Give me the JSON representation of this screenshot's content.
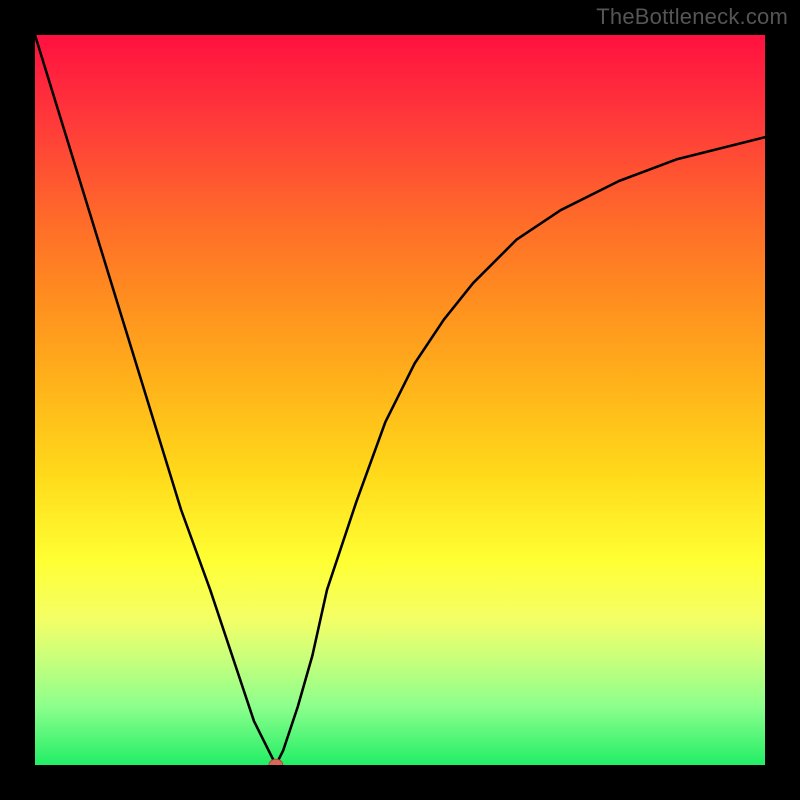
{
  "watermark": "TheBottleneck.com",
  "chart_data": {
    "type": "line",
    "title": "",
    "xlabel": "",
    "ylabel": "",
    "xlim": [
      0,
      100
    ],
    "ylim": [
      0,
      100
    ],
    "gradient_background": {
      "top_color": "#ff1040",
      "mid_colors": [
        "#ff6a2a",
        "#ffd91a",
        "#ffff33"
      ],
      "bottom_color": "#22ee66",
      "meaning": "red=high bottleneck, green=low bottleneck"
    },
    "series": [
      {
        "name": "bottleneck-curve-left",
        "x": [
          0,
          4,
          8,
          12,
          16,
          20,
          24,
          28,
          30,
          32,
          33
        ],
        "y": [
          100,
          87,
          74,
          61,
          48,
          35,
          24,
          12,
          6,
          2,
          0
        ]
      },
      {
        "name": "bottleneck-curve-right",
        "x": [
          33,
          34,
          36,
          38,
          40,
          44,
          48,
          52,
          56,
          60,
          66,
          72,
          80,
          88,
          100
        ],
        "y": [
          0,
          2,
          8,
          15,
          24,
          36,
          47,
          55,
          61,
          66,
          72,
          76,
          80,
          83,
          86
        ]
      }
    ],
    "marker": {
      "name": "optimal-point",
      "x": 33,
      "y": 0,
      "color": "#d46a5a",
      "shape": "ellipse"
    }
  }
}
